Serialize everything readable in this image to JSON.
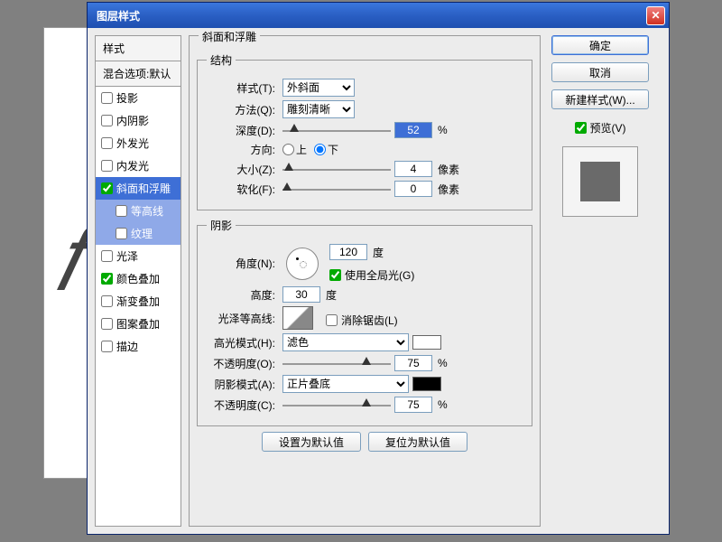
{
  "window": {
    "title": "图层样式"
  },
  "sidebar": {
    "header": "样式",
    "blend_header": "混合选项:默认",
    "items": [
      {
        "label": "投影",
        "checked": false
      },
      {
        "label": "内阴影",
        "checked": false
      },
      {
        "label": "外发光",
        "checked": false
      },
      {
        "label": "内发光",
        "checked": false
      },
      {
        "label": "斜面和浮雕",
        "checked": true,
        "selected": true
      },
      {
        "label": "等高线",
        "checked": false,
        "sub": true,
        "sel2": true
      },
      {
        "label": "纹理",
        "checked": false,
        "sub": true,
        "sel2": true
      },
      {
        "label": "光泽",
        "checked": false
      },
      {
        "label": "颜色叠加",
        "checked": true
      },
      {
        "label": "渐变叠加",
        "checked": false
      },
      {
        "label": "图案叠加",
        "checked": false
      },
      {
        "label": "描边",
        "checked": false
      }
    ]
  },
  "panel": {
    "title": "斜面和浮雕",
    "structure": {
      "legend": "结构",
      "style_label": "样式(T):",
      "style_val": "外斜面",
      "technique_label": "方法(Q):",
      "technique_val": "雕刻清晰",
      "depth_label": "深度(D):",
      "depth_val": "52",
      "depth_unit": "%",
      "direction_label": "方向:",
      "dir_up": "上",
      "dir_down": "下",
      "size_label": "大小(Z):",
      "size_val": "4",
      "size_unit": "像素",
      "soften_label": "软化(F):",
      "soften_val": "0",
      "soften_unit": "像素"
    },
    "shading": {
      "legend": "阴影",
      "angle_label": "角度(N):",
      "angle_val": "120",
      "angle_unit": "度",
      "global_light": "使用全局光(G)",
      "altitude_label": "高度:",
      "altitude_val": "30",
      "altitude_unit": "度",
      "gloss_label": "光泽等高线:",
      "antialias": "消除锯齿(L)",
      "highlight_mode_label": "高光模式(H):",
      "highlight_mode_val": "滤色",
      "highlight_opacity_label": "不透明度(O):",
      "highlight_opacity_val": "75",
      "opacity_unit": "%",
      "shadow_mode_label": "阴影模式(A):",
      "shadow_mode_val": "正片叠底",
      "shadow_opacity_label": "不透明度(C):",
      "shadow_opacity_val": "75"
    },
    "bottom": {
      "set_default": "设置为默认值",
      "reset_default": "复位为默认值"
    }
  },
  "right": {
    "ok": "确定",
    "cancel": "取消",
    "new_style": "新建样式(W)...",
    "preview": "预览(V)"
  }
}
